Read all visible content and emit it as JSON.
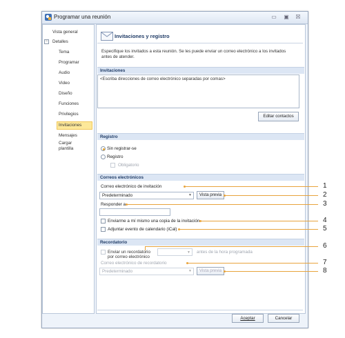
{
  "window": {
    "title": "Programar una reunión",
    "controls": {
      "minimize": "▭",
      "maximize": "▣",
      "close": "☒"
    }
  },
  "nav": {
    "items": [
      {
        "label": "Vista general"
      },
      {
        "label": "Detalles"
      },
      {
        "label": "Tema"
      },
      {
        "label": "Programar"
      },
      {
        "label": "Audio"
      },
      {
        "label": "Video"
      },
      {
        "label": "Diseño"
      },
      {
        "label": "Funciones"
      },
      {
        "label": "Privilegios"
      },
      {
        "label": "Invitaciones"
      },
      {
        "label": "Mensajes"
      },
      {
        "label": "Cargar"
      },
      {
        "label": "plantilla"
      }
    ],
    "tree_toggle": "−"
  },
  "header": {
    "title": "Invitaciones y registro",
    "description": "Especifique los invitados a esta reunión.  Se les puede enviar un correo electrónico a los invitados antes de atender."
  },
  "invitations": {
    "section_title": "Invitaciones",
    "placeholder": "<Escriba direcciones de correo electrónico separadas por comas>",
    "edit_contacts": "Editar contactos"
  },
  "registration": {
    "section_title": "Registro",
    "no_registration": "Sin registrar-se",
    "registration": "Registro",
    "mandatory": "Obligatorio"
  },
  "emails": {
    "section_title": "Correos electrónicos",
    "invitation_label": "Correo electrónico de invitación",
    "invitation_value": "Predeterminado",
    "preview": "Vista previa",
    "reply_to_label": "Responder a",
    "reply_to_value": "",
    "send_copy": "Enviarme a mí mismo una copia de la invitación",
    "attach_ical": "Adjuntar evento de calendario (iCal)"
  },
  "reminder": {
    "section_title": "Recordatorio",
    "send_reminder_1": "Enviar un recordatorio",
    "send_reminder_2": "por correo electrónico",
    "time_value": "",
    "before_text": "antes de la hora programada",
    "reminder_email_label": "Correo electrónico de recordatorio",
    "reminder_value": "Predeterminado",
    "preview": "Vista previa"
  },
  "footer": {
    "accept": "Aceptar",
    "cancel": "Cancelar"
  },
  "callouts": [
    "1",
    "2",
    "3",
    "4",
    "5",
    "6",
    "7",
    "8"
  ],
  "colors": {
    "accent": "#e8a33b",
    "selected_nav": "#fde89a",
    "section_header": "#dce6f4",
    "title_text": "#1f3b66"
  }
}
